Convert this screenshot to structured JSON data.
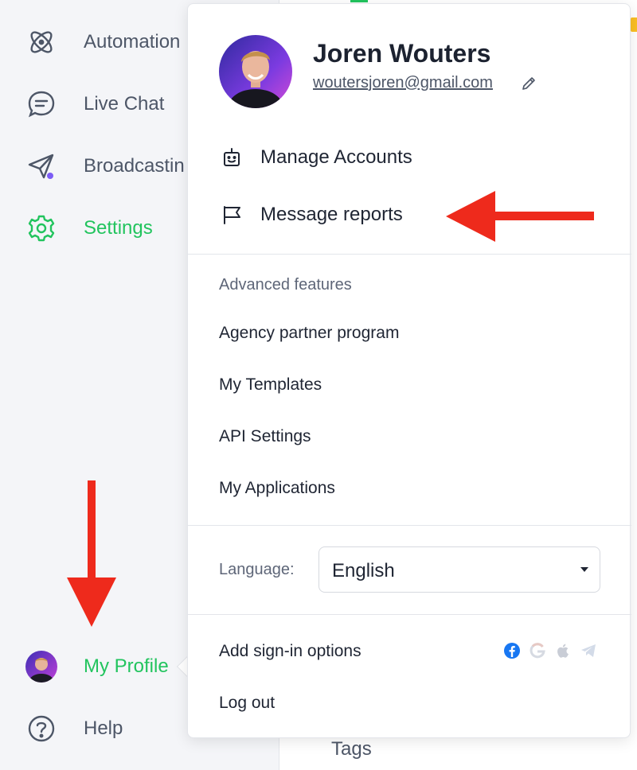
{
  "sidebar": {
    "items": [
      {
        "label": "Automation",
        "icon": "atom-icon"
      },
      {
        "label": "Live Chat",
        "icon": "chat-bubble-icon"
      },
      {
        "label": "Broadcastin",
        "icon": "paper-plane-icon"
      },
      {
        "label": "Settings",
        "icon": "gear-icon"
      }
    ],
    "profile_label": "My Profile",
    "help_label": "Help"
  },
  "main": {
    "tags_label": "Tags"
  },
  "popover": {
    "user_name": "Joren Wouters",
    "user_email": "woutersjoren@gmail.com",
    "menu": [
      {
        "label": "Manage Accounts",
        "icon": "robot-icon"
      },
      {
        "label": "Message reports",
        "icon": "flag-icon"
      }
    ],
    "advanced_heading": "Advanced features",
    "advanced_items": [
      "Agency partner program",
      "My Templates",
      "API Settings",
      "My Applications"
    ],
    "language_label": "Language:",
    "language_value": "English",
    "signin_label": "Add sign-in options",
    "logout_label": "Log out"
  },
  "colors": {
    "accent_green": "#22c45e",
    "annotation_red": "#ee2a1c",
    "facebook_blue": "#1877f2",
    "telegram_gray": "#c9cdd6"
  }
}
